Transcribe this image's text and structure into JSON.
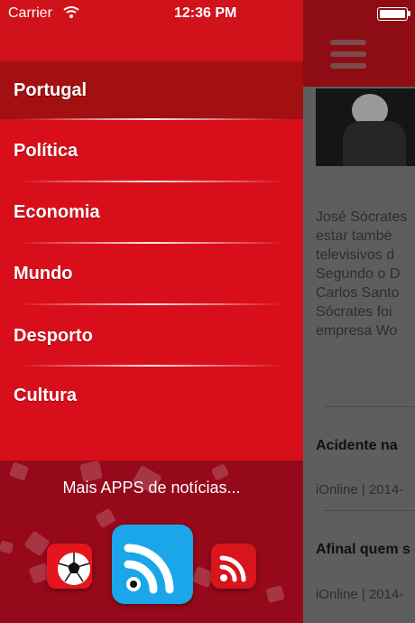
{
  "status_bar": {
    "carrier": "Carrier",
    "time": "12:36 PM"
  },
  "menu": {
    "items": [
      {
        "label": "Portugal",
        "active": true
      },
      {
        "label": "Política",
        "active": false
      },
      {
        "label": "Economia",
        "active": false
      },
      {
        "label": "Mundo",
        "active": false
      },
      {
        "label": "Desporto",
        "active": false
      },
      {
        "label": "Cultura",
        "active": false
      }
    ]
  },
  "more_apps": {
    "label": "Mais APPS de notícias..."
  },
  "article": {
    "excerpt": "José Sócrates\nestar també\ntelevisivos d\nSegundo o D\nCarlos Santo\nSócrates foi\nempresa Wo"
  },
  "articles": [
    {
      "headline": "Acidente na",
      "meta": "iOnline | 2014-"
    },
    {
      "headline": "Afinal quem s",
      "meta": "iOnline | 2014-"
    }
  ],
  "colors": {
    "primary_red": "#d80f1b",
    "active_red": "#a31012",
    "dark_red": "#8a0a12"
  }
}
